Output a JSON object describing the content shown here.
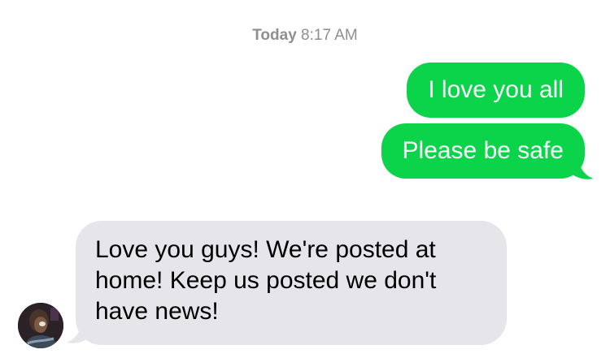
{
  "conversation": {
    "timestamp": {
      "day": "Today",
      "time": "8:17 AM"
    },
    "messages": [
      {
        "direction": "outgoing",
        "text": "I love you all"
      },
      {
        "direction": "outgoing",
        "text": "Please be safe"
      },
      {
        "direction": "incoming",
        "text": "Love you guys! We're posted at home! Keep us posted we don't have news!"
      }
    ]
  },
  "colors": {
    "outgoing_bubble": "#0bd34a",
    "incoming_bubble": "#e5e5ea",
    "timestamp_text": "#8e8e93"
  },
  "icons": {
    "avatar": "contact-avatar-photo"
  }
}
